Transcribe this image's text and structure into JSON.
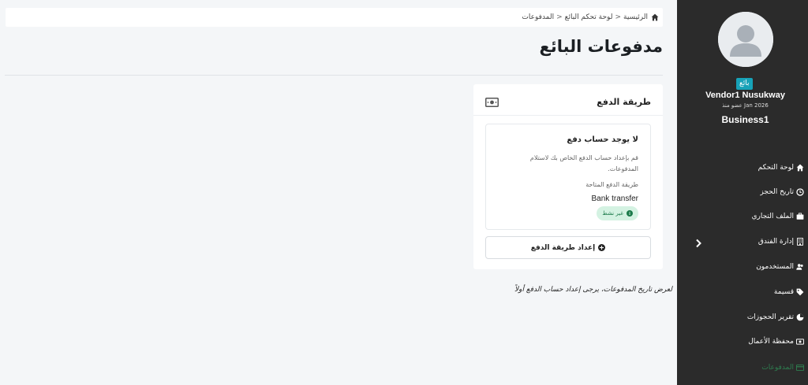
{
  "breadcrumb": {
    "home": "الرئيسية",
    "dashboard": "لوحة تحكم البائع",
    "current": "المدفوعات",
    "separator": "<"
  },
  "page": {
    "title": "مدفوعات البائع",
    "history_note": "لعرض تاريخ المدفوعات، يرجى إعداد حساب الدفع أولاً"
  },
  "card": {
    "title": "طريقة الدفع",
    "empty_title": "لا يوجد حساب دفع",
    "empty_desc": "قم بإعداد حساب الدفع الخاص بك لاستلام المدفوعات.",
    "method_label": "طريقة الدفع المتاحة",
    "method_value": "Bank transfer",
    "status": "غير نشط",
    "setup_button": "إعداد طريقة الدفع"
  },
  "user": {
    "role": "بائع",
    "name": "Vendor1 Nusukway",
    "member_since": "عضو منذ Jan 2026",
    "business": "Business1"
  },
  "sidebar": {
    "items": [
      {
        "label": "لوحة التحكم",
        "icon": "home-icon"
      },
      {
        "label": "تاريخ الحجز",
        "icon": "clock-icon"
      },
      {
        "label": "الملف التجاري",
        "icon": "briefcase-icon"
      },
      {
        "label": "إدارة الفندق",
        "icon": "building-icon"
      },
      {
        "label": "المستخدمون",
        "icon": "users-icon"
      },
      {
        "label": "قسيمة",
        "icon": "tag-icon"
      },
      {
        "label": "تقرير الحجوزات",
        "icon": "pie-chart-icon"
      },
      {
        "label": "محفظة الأعمال",
        "icon": "money-icon"
      },
      {
        "label": "المدفوعات",
        "icon": "credit-card-icon"
      }
    ]
  },
  "colors": {
    "sidebar_bg": "#2b2b2b",
    "badge_bg": "#17a2b8",
    "status_bg": "#d4f2e2",
    "status_text": "#1b7a4a",
    "active_item": "#2e7d4f"
  }
}
